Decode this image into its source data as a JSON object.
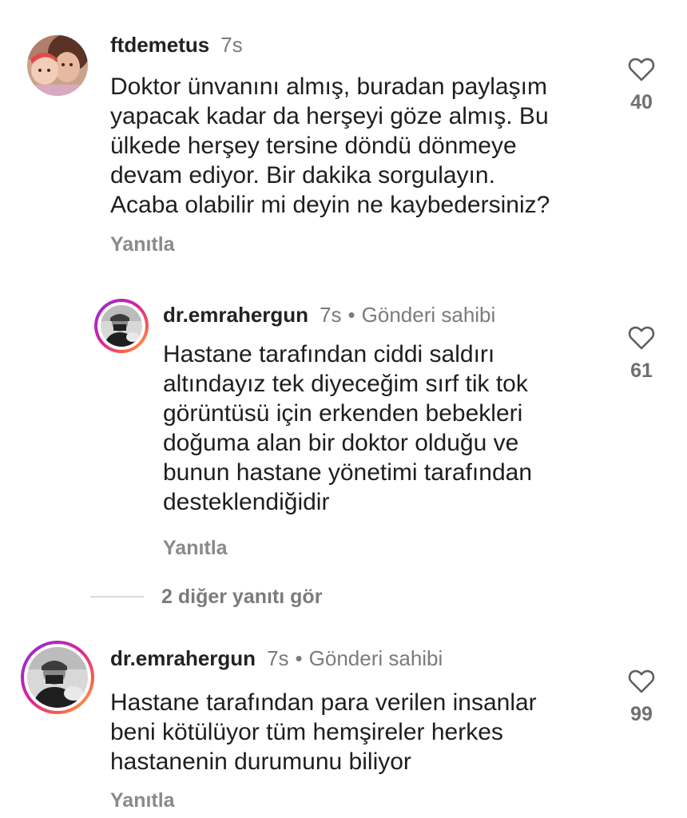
{
  "comments": [
    {
      "username": "ftdemetus",
      "time": "7s",
      "body_lines": [
        "Doktor ünvanını almış, buradan paylaşım",
        "yapacak kadar da herşeyi göze almış. Bu",
        "ülkede herşey tersine döndü dönmeye",
        "devam ediyor. Bir dakika sorgulayın.",
        "Acaba olabilir mi deyin ne kaybedersiniz?"
      ],
      "reply_label": "Yanıtla",
      "like_count": "40"
    },
    {
      "username": "dr.emrahergun",
      "time": "7s",
      "separator": "•",
      "owner_label": "Gönderi sahibi",
      "body_lines": [
        "Hastane tarafından ciddi saldırı",
        "altındayız tek diyeceğim sırf tik tok",
        "görüntüsü için erkenden bebekleri",
        "doğuma alan bir doktor olduğu ve",
        "bunun hastane yönetimi tarafından",
        "desteklendiğidir"
      ],
      "reply_label": "Yanıtla",
      "like_count": "61"
    },
    {
      "username": "dr.emrahergun",
      "time": "7s",
      "separator": "•",
      "owner_label": "Gönderi sahibi",
      "body_lines": [
        "Hastane tarafından para verilen insanlar",
        "beni kötülüyor tüm hemşireler herkes",
        "hastanenin durumunu biliyor"
      ],
      "reply_label": "Yanıtla",
      "like_count": "99"
    }
  ],
  "view_more_replies": "2 diğer yanıtı gör",
  "icons": {
    "like": "heart-outline-icon"
  },
  "colors": {
    "story_ring_start": "#8a2be2",
    "story_ring_end": "#fdca4a",
    "muted_text": "#7b7b7b"
  }
}
